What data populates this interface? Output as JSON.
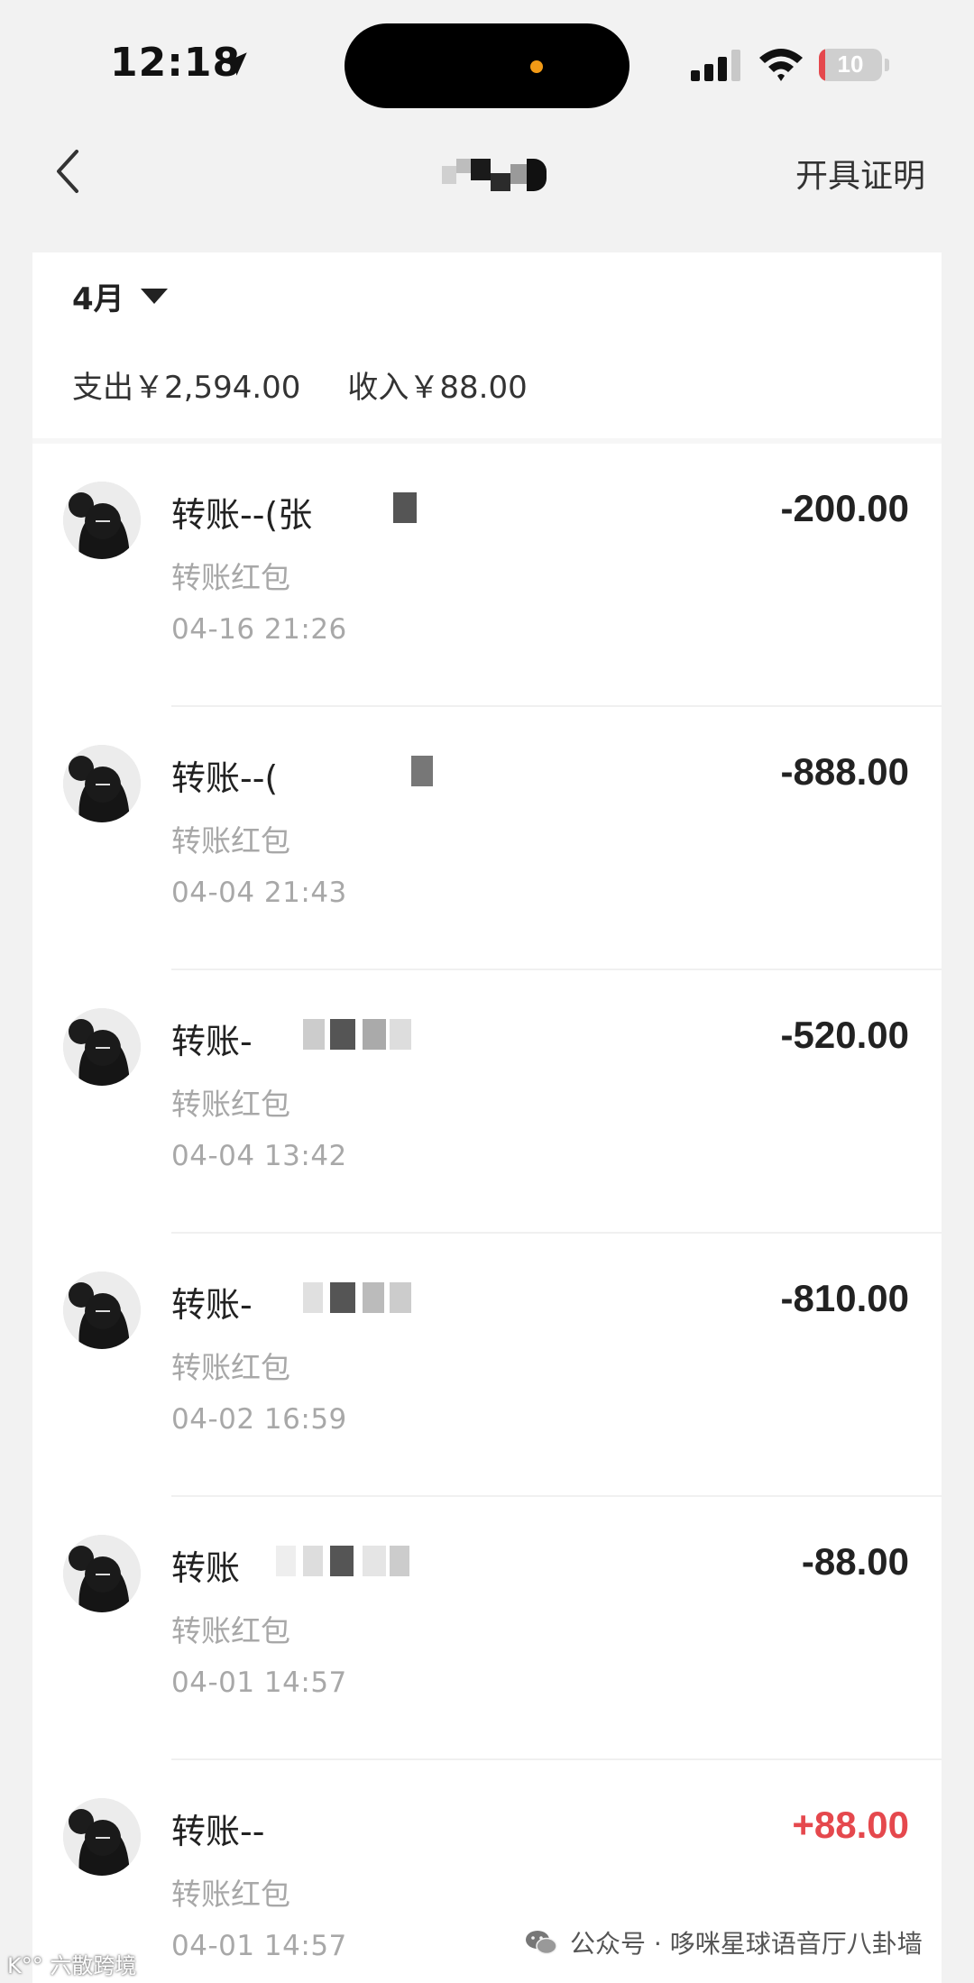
{
  "status_bar": {
    "time": "12:18",
    "battery_level": "10",
    "battery_fraction": 0.1,
    "battery_color": "#e5484d"
  },
  "nav": {
    "back_icon": "chevron-left-icon",
    "action_label": "开具证明"
  },
  "filter": {
    "month_label": "4月",
    "caret_icon": "triangle-down-icon"
  },
  "summary": {
    "expense": "支出￥2,594.00",
    "income": "收入￥88.00"
  },
  "colors": {
    "income_red": "#e5484d",
    "secondary_gray": "#a8a8a8",
    "background": "#f2f2f2"
  },
  "transactions": [
    {
      "title": "转账--(张",
      "subtitle": "转账红包",
      "time": "04-16 21:26",
      "amount": "-200.00",
      "type": "expense"
    },
    {
      "title": "转账--(",
      "subtitle": "转账红包",
      "time": "04-04 21:43",
      "amount": "-888.00",
      "type": "expense"
    },
    {
      "title": "转账-",
      "subtitle": "转账红包",
      "time": "04-04 13:42",
      "amount": "-520.00",
      "type": "expense"
    },
    {
      "title": "转账-",
      "subtitle": "转账红包",
      "time": "04-02 16:59",
      "amount": "-810.00",
      "type": "expense"
    },
    {
      "title": "转账",
      "subtitle": "转账红包",
      "time": "04-01 14:57",
      "amount": "-88.00",
      "type": "expense"
    },
    {
      "title": "转账--",
      "subtitle": "转账红包",
      "time": "04-01 14:57",
      "amount": "+88.00",
      "type": "income"
    }
  ],
  "watermark": {
    "left": "K°° 六散跨境",
    "right": "公众号 · 哆咪星球语音厅八卦墙",
    "icon": "wechat-icon"
  }
}
